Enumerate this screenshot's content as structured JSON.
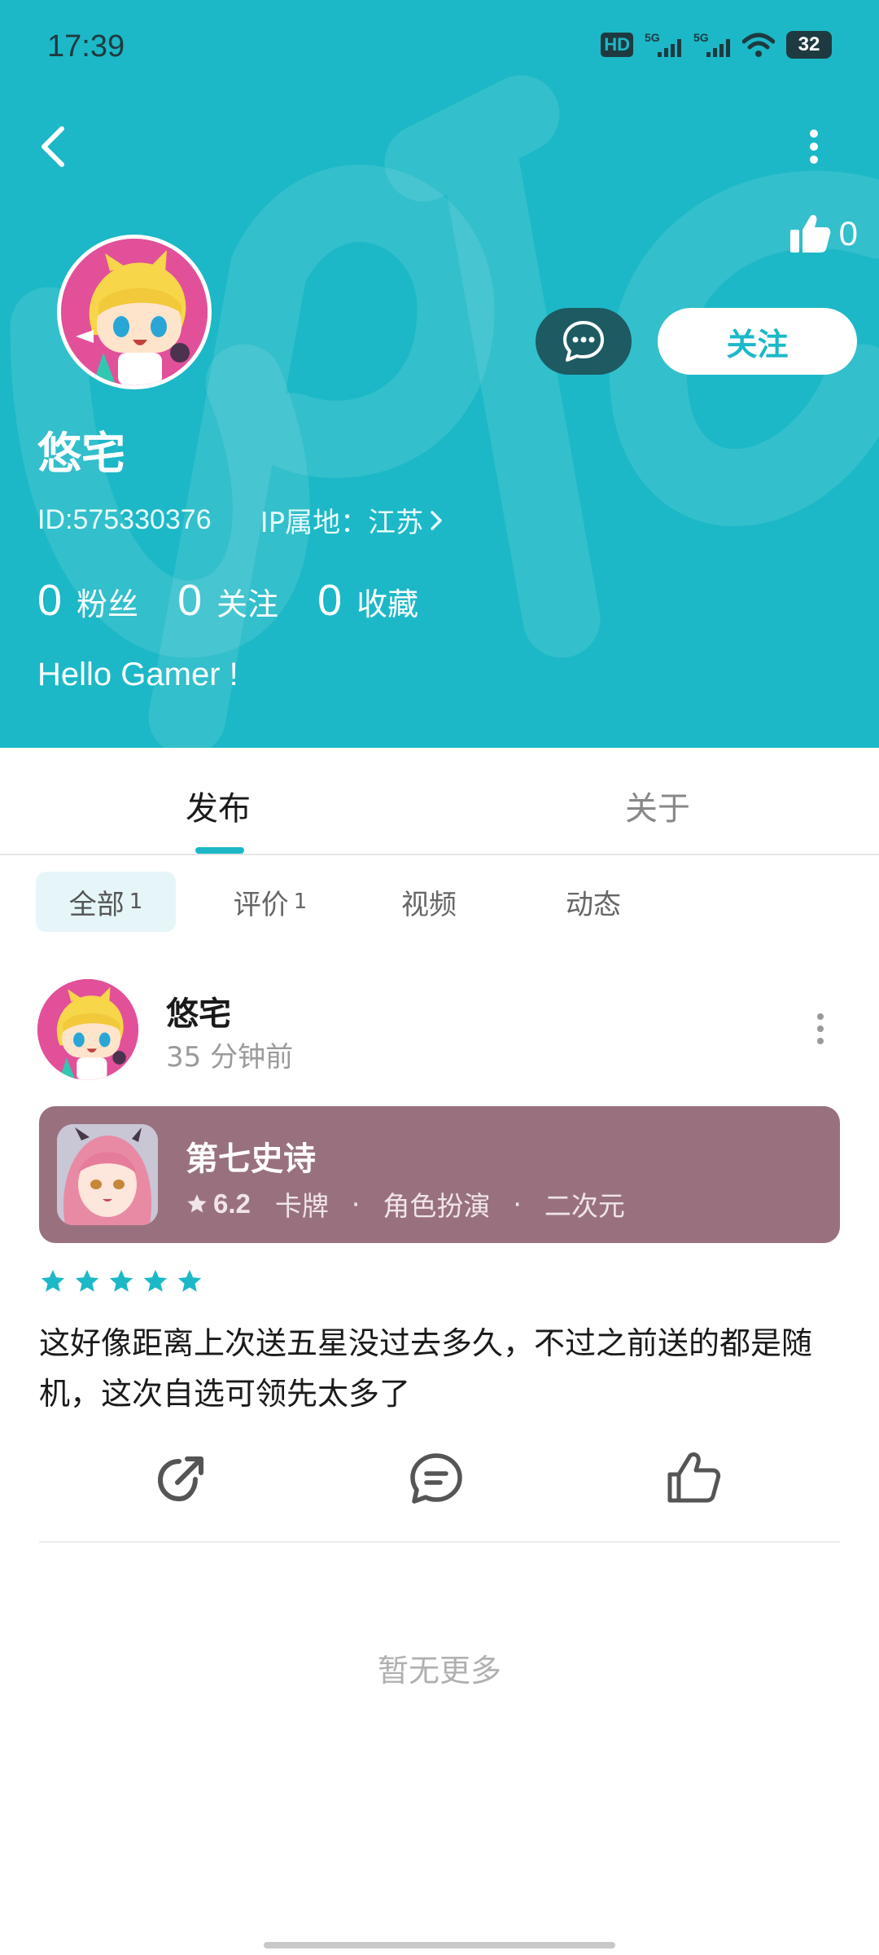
{
  "status_bar": {
    "time": "17:39",
    "battery": "32",
    "network_1": "5G",
    "network_2": "5G",
    "hd": "HD"
  },
  "profile": {
    "likes": "0",
    "username": "悠宅",
    "id_text": "ID:575330376",
    "ip_text": "IP属地：江苏",
    "follow_label": "关注",
    "stats": [
      {
        "num": "0",
        "label": "粉丝"
      },
      {
        "num": "0",
        "label": "关注"
      },
      {
        "num": "0",
        "label": "收藏"
      }
    ],
    "bio": "Hello Gamer !"
  },
  "tabs": [
    {
      "label": "发布",
      "active": true
    },
    {
      "label": "关于",
      "active": false
    }
  ],
  "filters": [
    {
      "label": "全部",
      "count": "1",
      "active": true
    },
    {
      "label": "评价",
      "count": "1",
      "active": false
    },
    {
      "label": "视频",
      "count": "",
      "active": false
    },
    {
      "label": "动态",
      "count": "",
      "active": false
    }
  ],
  "post": {
    "author": "悠宅",
    "time": "35 分钟前",
    "game": {
      "title": "第七史诗",
      "rating": "6.2",
      "tags": [
        "卡牌",
        "角色扮演",
        "二次元"
      ]
    },
    "star_rating": 5,
    "text": "这好像距离上次送五星没过去多久，不过之前送的都是随机，这次自选可领先太多了"
  },
  "footer": {
    "no_more": "暂无更多"
  },
  "colors": {
    "accent": "#1cb8c7",
    "card": "#99717e",
    "message_button": "#1d5a62"
  },
  "icons": [
    "back-arrow-icon",
    "more-vertical-icon",
    "thumbs-up-icon",
    "chat-bubble-icon",
    "chevron-right-icon",
    "star-icon",
    "share-icon",
    "comment-icon"
  ]
}
